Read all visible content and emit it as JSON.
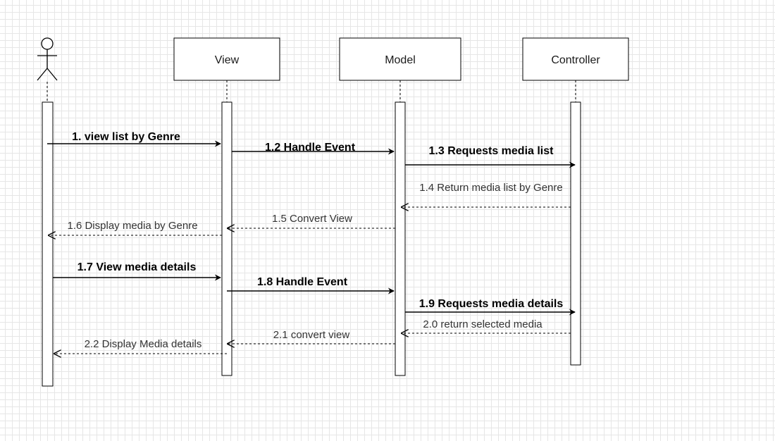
{
  "participants": [
    {
      "id": "actor",
      "type": "actor",
      "label": ""
    },
    {
      "id": "view",
      "type": "box",
      "label": "View"
    },
    {
      "id": "model",
      "type": "box",
      "label": "Model"
    },
    {
      "id": "controller",
      "type": "box",
      "label": "Controller"
    }
  ],
  "messages": [
    {
      "id": "m1_1",
      "label": "1. view list by Genre",
      "from": "actor",
      "to": "view",
      "kind": "sync",
      "bold": true
    },
    {
      "id": "m1_2",
      "label": "1.2 Handle Event",
      "from": "view",
      "to": "model",
      "kind": "sync",
      "bold": true
    },
    {
      "id": "m1_3",
      "label": "1.3 Requests media list",
      "from": "model",
      "to": "controller",
      "kind": "sync",
      "bold": true
    },
    {
      "id": "m1_4",
      "label": "1.4 Return media list by Genre",
      "from": "controller",
      "to": "model",
      "kind": "return",
      "bold": false
    },
    {
      "id": "m1_5",
      "label": "1.5  Convert View",
      "from": "model",
      "to": "view",
      "kind": "return",
      "bold": false
    },
    {
      "id": "m1_6",
      "label": "1.6 Display media by Genre",
      "from": "view",
      "to": "actor",
      "kind": "return",
      "bold": false
    },
    {
      "id": "m1_7",
      "label": "1.7 View media details",
      "from": "actor",
      "to": "view",
      "kind": "sync",
      "bold": true
    },
    {
      "id": "m1_8",
      "label": "1.8 Handle Event",
      "from": "view",
      "to": "model",
      "kind": "sync",
      "bold": true
    },
    {
      "id": "m1_9",
      "label": "1.9 Requests media details",
      "from": "model",
      "to": "controller",
      "kind": "sync",
      "bold": true
    },
    {
      "id": "m2_0",
      "label": "2.0 return selected media",
      "from": "controller",
      "to": "model",
      "kind": "return",
      "bold": false
    },
    {
      "id": "m2_1",
      "label": "2.1 convert view",
      "from": "model",
      "to": "view",
      "kind": "return",
      "bold": false
    },
    {
      "id": "m2_2",
      "label": "2.2 Display Media details",
      "from": "view",
      "to": "actor",
      "kind": "return",
      "bold": false
    }
  ],
  "colors": {
    "line": "#000000",
    "grid": "#e6e6e6",
    "background": "#ffffff"
  }
}
